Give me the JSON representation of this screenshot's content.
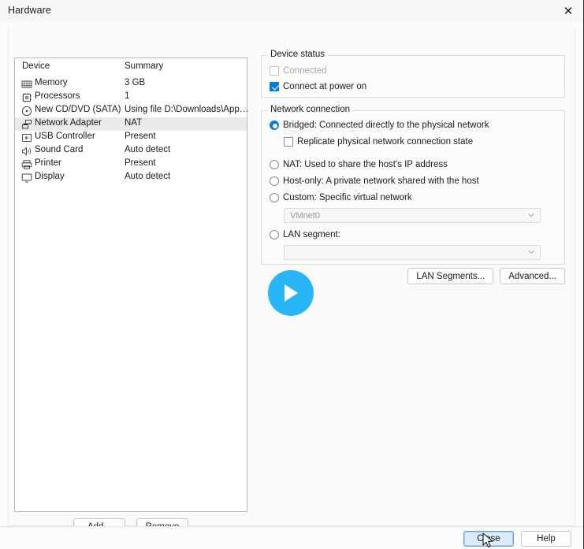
{
  "window": {
    "title": "Hardware",
    "close_icon": "close-icon"
  },
  "device_list": {
    "columns": [
      "Device",
      "Summary"
    ],
    "rows": [
      {
        "icon": "memory-icon",
        "name": "Memory",
        "summary": "3 GB",
        "selected": false
      },
      {
        "icon": "cpu-icon",
        "name": "Processors",
        "summary": "1",
        "selected": false
      },
      {
        "icon": "disc-icon",
        "name": "New CD/DVD (SATA)",
        "summary": "Using file D:\\Downloads\\App…",
        "selected": false
      },
      {
        "icon": "network-icon",
        "name": "Network Adapter",
        "summary": "NAT",
        "selected": true
      },
      {
        "icon": "usb-icon",
        "name": "USB Controller",
        "summary": "Present",
        "selected": false
      },
      {
        "icon": "speaker-icon",
        "name": "Sound Card",
        "summary": "Auto detect",
        "selected": false
      },
      {
        "icon": "printer-icon",
        "name": "Printer",
        "summary": "Present",
        "selected": false
      },
      {
        "icon": "display-icon",
        "name": "Display",
        "summary": "Auto detect",
        "selected": false
      }
    ],
    "add_label": "Add...",
    "remove_label": "Remove"
  },
  "device_status": {
    "title": "Device status",
    "connected": {
      "label": "Connected",
      "checked": false,
      "disabled": true
    },
    "connect_at_power_on": {
      "label": "Connect at power on",
      "checked": true,
      "disabled": false
    }
  },
  "network_connection": {
    "title": "Network connection",
    "options": [
      {
        "label": "Bridged: Connected directly to the physical network",
        "selected": true
      },
      {
        "label": "NAT: Used to share the host's IP address",
        "selected": false
      },
      {
        "label": "Host-only: A private network shared with the host",
        "selected": false
      },
      {
        "label": "Custom: Specific virtual network",
        "selected": false
      },
      {
        "label": "LAN segment:",
        "selected": false
      }
    ],
    "replicate": {
      "label": "Replicate physical network connection state",
      "checked": false
    },
    "custom_network_value": "VMnet0",
    "lan_segment_value": "",
    "lan_segments_button": "LAN Segments...",
    "advanced_button": "Advanced..."
  },
  "overlay": {
    "play_icon": "play-icon"
  },
  "footer": {
    "close_label": "Close",
    "help_label": "Help"
  },
  "colors": {
    "accent": "#0b7ad8",
    "play_blue": "#29b6f6",
    "selection": "#eaeaea"
  }
}
